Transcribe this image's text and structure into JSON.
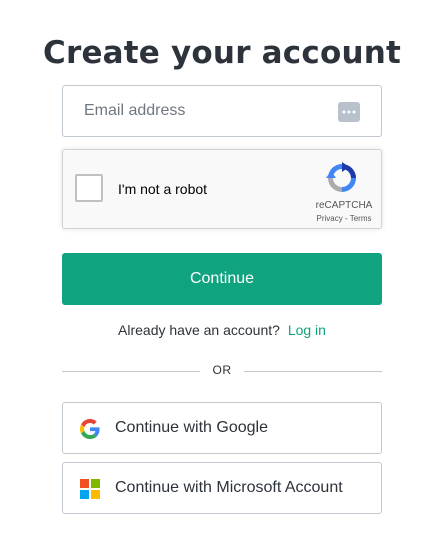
{
  "page": {
    "title": "Create your account"
  },
  "email": {
    "placeholder": "Email address",
    "value": "",
    "autofill_icon": "password-manager-icon"
  },
  "recaptcha": {
    "label": "I'm not a robot",
    "brand": "reCAPTCHA",
    "privacy": "Privacy",
    "separator": " - ",
    "terms": "Terms",
    "checked": false
  },
  "continue_button": {
    "label": "Continue",
    "color": "#10a37f"
  },
  "login_prompt": {
    "text": "Already have an account?",
    "link": "Log in"
  },
  "divider": {
    "text": "OR"
  },
  "social": {
    "google": {
      "label": "Continue with Google",
      "icon": "google-icon"
    },
    "microsoft": {
      "label": "Continue with Microsoft Account",
      "icon": "microsoft-icon"
    }
  },
  "colors": {
    "accent": "#10a37f",
    "text": "#2d333a",
    "border": "#c2c8d0"
  }
}
